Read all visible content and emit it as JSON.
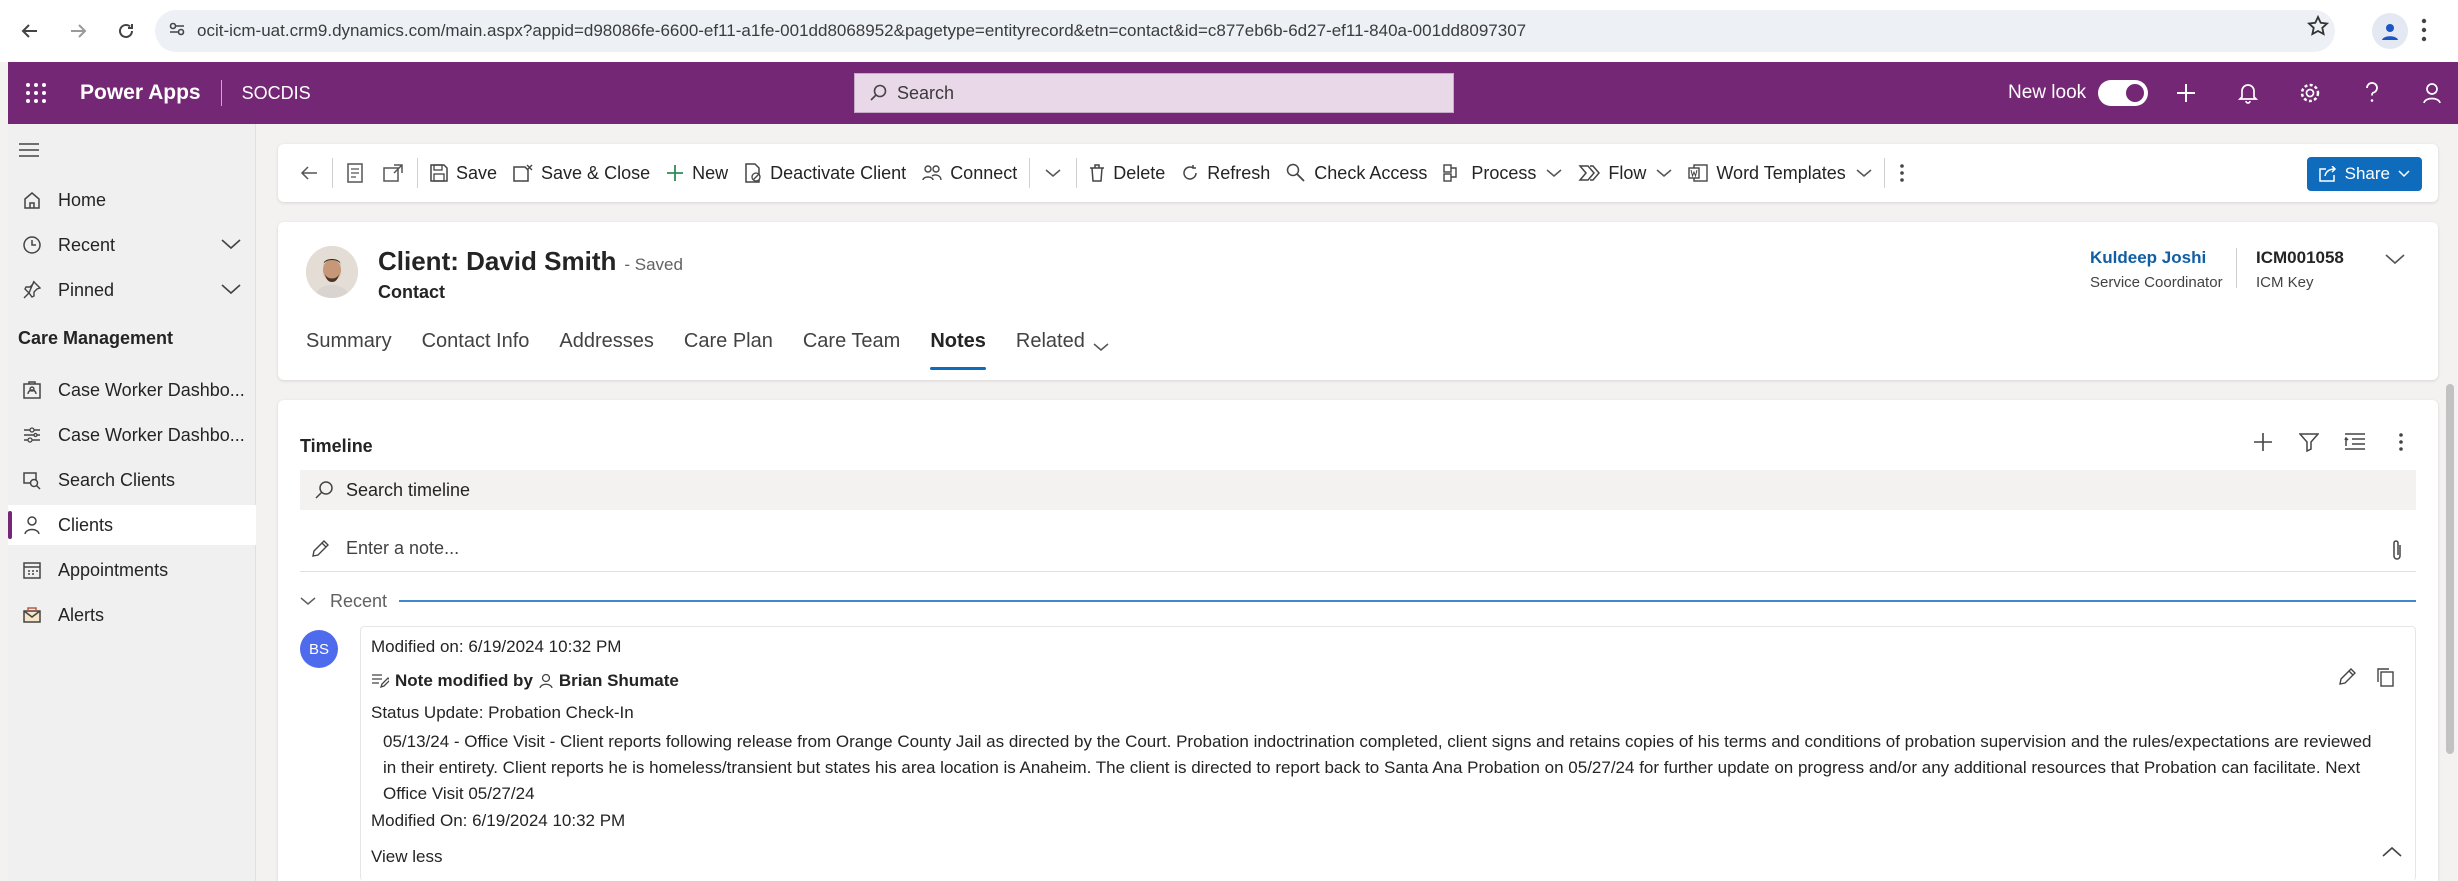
{
  "browser": {
    "url": "ocit-icm-uat.crm9.dynamics.com/main.aspx?appid=d98086fe-6600-ef11-a1fe-001dd8068952&pagetype=entityrecord&etn=contact&id=c877eb6b-6d27-ef11-840a-001dd8097307"
  },
  "app": {
    "name": "Power Apps",
    "environment": "SOCDIS",
    "search_placeholder": "Search",
    "new_look_label": "New look",
    "new_look_on": true,
    "brand_color": "#742774"
  },
  "sidebar": {
    "items": [
      {
        "label": "Home",
        "icon": "home-icon"
      },
      {
        "label": "Recent",
        "icon": "clock-icon"
      },
      {
        "label": "Pinned",
        "icon": "pin-icon"
      }
    ],
    "group_title": "Care Management",
    "group_items": [
      {
        "label": "Case Worker Dashbo...",
        "icon": "dashboard-icon"
      },
      {
        "label": "Case Worker Dashbo...",
        "icon": "dashboard-alt-icon"
      },
      {
        "label": "Search Clients",
        "icon": "search-clients-icon"
      },
      {
        "label": "Clients",
        "icon": "person-icon",
        "active": true
      },
      {
        "label": "Appointments",
        "icon": "calendar-icon"
      },
      {
        "label": "Alerts",
        "icon": "mail-alert-icon"
      }
    ]
  },
  "commands": {
    "save": "Save",
    "save_close": "Save & Close",
    "new": "New",
    "deactivate": "Deactivate Client",
    "connect": "Connect",
    "delete": "Delete",
    "refresh": "Refresh",
    "check_access": "Check Access",
    "process": "Process",
    "flow": "Flow",
    "word_templates": "Word Templates",
    "share": "Share"
  },
  "record": {
    "title": "Client: David Smith",
    "status": "- Saved",
    "entity": "Contact",
    "owner_name": "Kuldeep Joshi",
    "owner_role": "Service Coordinator",
    "key_value": "ICM001058",
    "key_label": "ICM Key",
    "tabs": [
      "Summary",
      "Contact Info",
      "Addresses",
      "Care Plan",
      "Care Team",
      "Notes",
      "Related"
    ],
    "selected_tab": "Notes"
  },
  "timeline": {
    "title": "Timeline",
    "search_placeholder": "Search timeline",
    "note_placeholder": "Enter a note...",
    "section": "Recent",
    "entry": {
      "avatar_initials": "BS",
      "modified_on": "Modified on: 6/19/2024 10:32 PM",
      "action_prefix": "Note modified by",
      "author": "Brian Shumate",
      "subject": "Status Update: Probation Check-In",
      "body": "05/13/24 - Office Visit - Client reports following release from Orange County Jail as directed by the Court. Probation indoctrination completed, client signs and retains copies of his terms and conditions of probation supervision and the rules/expectations are reviewed in their entirety. Client reports he is homeless/transient but states his area location is Anaheim. The client is directed to report back to Santa Ana Probation on 05/27/24 for further update on progress and/or any additional resources that Probation can facilitate. Next Office Visit 05/27/24",
      "modified_on_footer": "Modified On: 6/19/2024 10:32 PM",
      "view_less": "View less"
    }
  }
}
